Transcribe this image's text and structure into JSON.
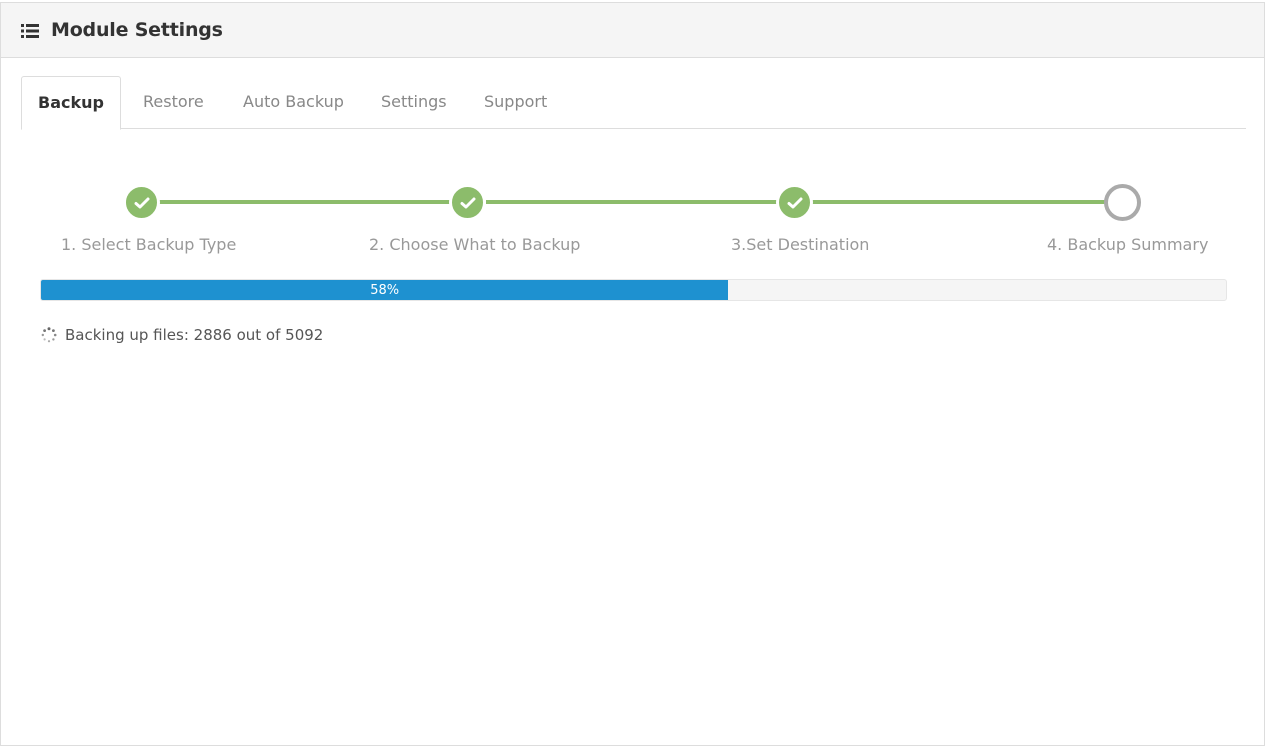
{
  "header": {
    "title": "Module Settings",
    "icon": "list-icon"
  },
  "tabs": [
    {
      "label": "Backup",
      "active": true
    },
    {
      "label": "Restore",
      "active": false
    },
    {
      "label": "Auto Backup",
      "active": false
    },
    {
      "label": "Settings",
      "active": false
    },
    {
      "label": "Support",
      "active": false
    }
  ],
  "steps": [
    {
      "label": "1. Select Backup Type",
      "status": "complete"
    },
    {
      "label": "2. Choose What to Backup",
      "status": "complete"
    },
    {
      "label": "3.Set Destination",
      "status": "complete"
    },
    {
      "label": "4. Backup Summary",
      "status": "pending"
    }
  ],
  "progress": {
    "percent": 58,
    "label": "58%"
  },
  "status": {
    "text": "Backing up files: 2886 out of 5092",
    "icon": "spinner-icon"
  },
  "colors": {
    "step_complete": "#8cbc6b",
    "step_pending": "#aaaaaa",
    "progress_bar": "#1e91d0",
    "heading_bg": "#f5f5f5"
  }
}
